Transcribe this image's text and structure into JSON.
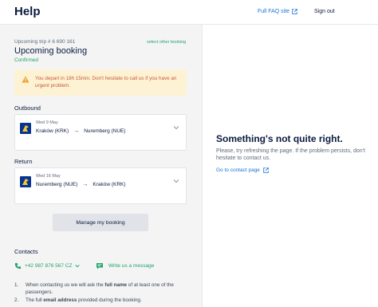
{
  "header": {
    "title": "Help",
    "faq_label": "Full FAQ site",
    "signout_label": "Sign out"
  },
  "booking": {
    "trip_number": "Upcoming trip # 6 690 161",
    "select_other": "select other booking",
    "title": "Upcoming booking",
    "status": "Confirmed",
    "alert": "You depart in 18h 15min. Don't hesitate to call us if you have an urgent problem."
  },
  "outbound": {
    "label": "Outbound",
    "date": "Wed 9 May",
    "from": "Kraków (KRK)",
    "to": "Nuremberg (NUE)"
  },
  "return": {
    "label": "Return",
    "date": "Wed 16 May",
    "from": "Nuremberg (NUE)",
    "to": "Kraków (KRK)"
  },
  "manage_button": "Manage my booking",
  "contacts": {
    "title": "Contacts",
    "phone": "+42 987 876 567 CZ",
    "message": "Write us a message",
    "instructions": [
      {
        "num": "1.",
        "text_a": "When contacting us we will ask the ",
        "bold": "full name",
        "text_b": " of at least one of the passengers."
      },
      {
        "num": "2.",
        "text_a": "The full ",
        "bold": "email address",
        "text_b": " provided during the booking."
      }
    ]
  },
  "error": {
    "title": "Something's not quite right.",
    "subtitle": "Please, try refreshing the page. If the problem persists, don't hesitate to contact us.",
    "contact_link": "Go to contact page"
  },
  "colors": {
    "brand_navy": "#073590",
    "accent_green": "#23a46c",
    "link_blue": "#1976d2",
    "alert_bg": "#fdf3d4",
    "alert_text": "#c9583b"
  }
}
